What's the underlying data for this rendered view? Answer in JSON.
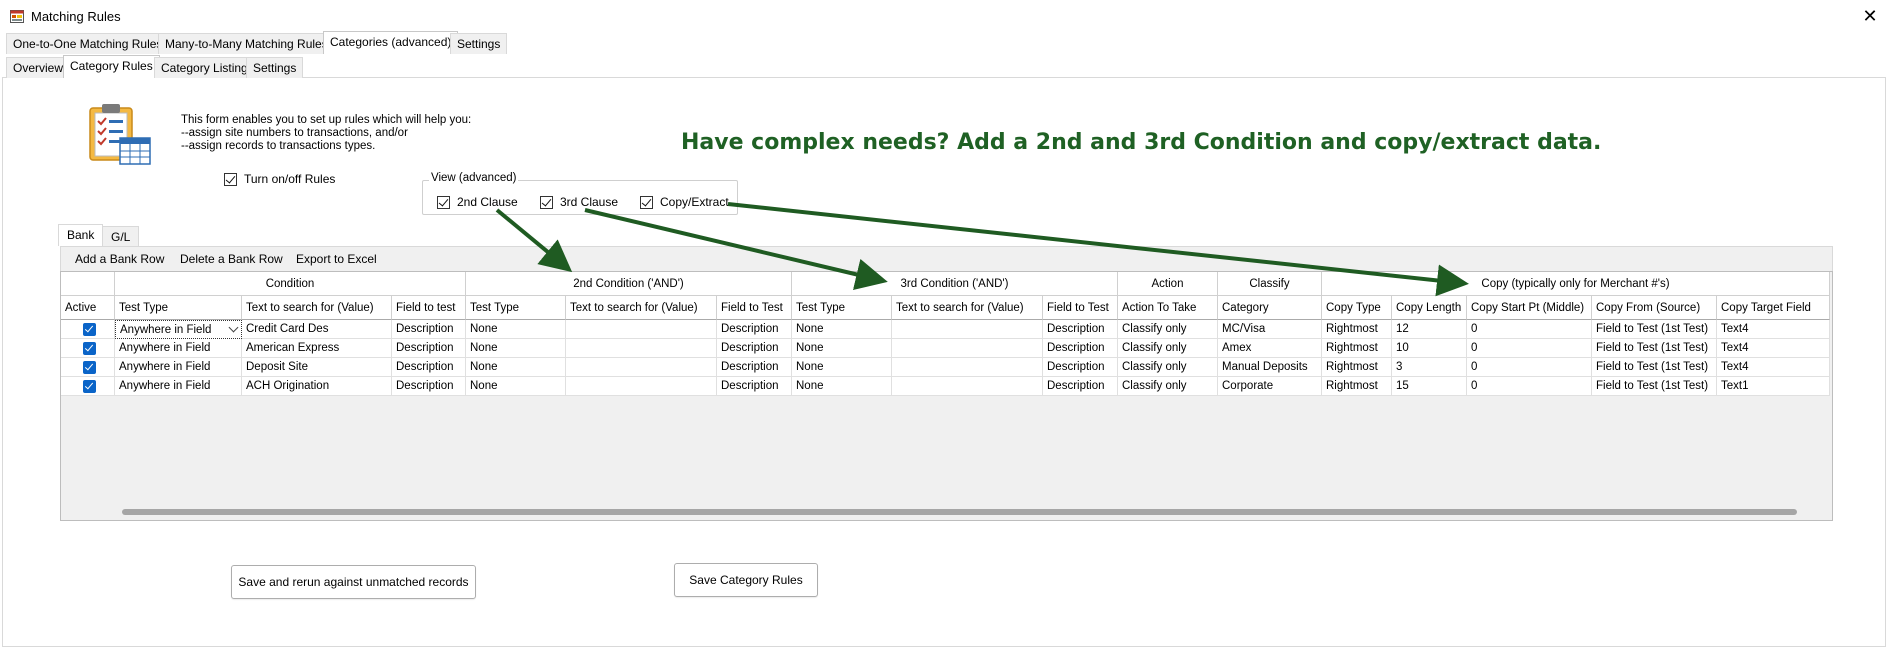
{
  "window": {
    "title": "Matching Rules",
    "close_glyph": "✕"
  },
  "main_tabs": [
    {
      "label": "One-to-One Matching Rules"
    },
    {
      "label": "Many-to-Many Matching Rules"
    },
    {
      "label": "Categories (advanced)"
    },
    {
      "label": "Settings"
    }
  ],
  "sub_tabs": [
    {
      "label": "Overview"
    },
    {
      "label": "Category Rules"
    },
    {
      "label": "Category Listing"
    },
    {
      "label": "Settings"
    }
  ],
  "intro": {
    "line1": "This form enables you to set up rules which will help you:",
    "line2": "--assign site numbers to transactions, and/or",
    "line3": "--assign records to transactions types."
  },
  "headline": "Have complex needs? Add a 2nd and 3rd Condition and copy/extract data.",
  "turn_on_off": {
    "label": "Turn on/off Rules",
    "checked": true
  },
  "view_advanced": {
    "legend": "View (advanced)",
    "second_clause": "2nd Clause",
    "third_clause": "3rd Clause",
    "copy_extract": "Copy/Extract"
  },
  "bank_tabs": [
    {
      "label": "Bank"
    },
    {
      "label": "G/L"
    }
  ],
  "toolbar": {
    "add_row": "Add a Bank Row",
    "delete_row": "Delete a Bank Row",
    "export": "Export to Excel"
  },
  "grid": {
    "groups": {
      "condition": "Condition",
      "cond2": "2nd Condition ('AND')",
      "cond3": "3rd Condition ('AND')",
      "action": "Action",
      "classify": "Classify",
      "copy": "Copy (typically only for Merchant #'s)"
    },
    "headers": {
      "active": "Active",
      "test_type": "Test Type",
      "text_search": "Text to search for (Value)",
      "field_test": "Field to test",
      "test_type2": "Test Type",
      "text_search2": "Text to search for (Value)",
      "field_test2": "Field to Test",
      "test_type3": "Test Type",
      "text_search3": "Text to search for (Value)",
      "field_test3": "Field to Test",
      "action": "Action To Take",
      "category": "Category",
      "copy_type": "Copy Type",
      "copy_length": "Copy Length",
      "copy_start": "Copy Start Pt (Middle)",
      "copy_from": "Copy From (Source)",
      "copy_target": "Copy Target Field"
    },
    "rows": [
      {
        "test_type": "Anywhere in Field",
        "text": "Credit Card Des",
        "field": "Description",
        "tt2": "None",
        "v2": "",
        "f2": "Description",
        "tt3": "None",
        "v3": "",
        "f3": "Description",
        "action": "Classify only",
        "category": "MC/Visa",
        "copy_type": "Rightmost",
        "copy_length": "12",
        "copy_start": "0",
        "copy_from": "Field to Test (1st Test)",
        "copy_target": "Text4"
      },
      {
        "test_type": "Anywhere in Field",
        "text": "American Express",
        "field": "Description",
        "tt2": "None",
        "v2": "",
        "f2": "Description",
        "tt3": "None",
        "v3": "",
        "f3": "Description",
        "action": "Classify only",
        "category": "Amex",
        "copy_type": "Rightmost",
        "copy_length": "10",
        "copy_start": "0",
        "copy_from": "Field to Test (1st Test)",
        "copy_target": "Text4"
      },
      {
        "test_type": "Anywhere in Field",
        "text": "Deposit Site",
        "field": "Description",
        "tt2": "None",
        "v2": "",
        "f2": "Description",
        "tt3": "None",
        "v3": "",
        "f3": "Description",
        "action": "Classify only",
        "category": "Manual Deposits",
        "copy_type": "Rightmost",
        "copy_length": "3",
        "copy_start": "0",
        "copy_from": "Field to Test (1st Test)",
        "copy_target": "Text4"
      },
      {
        "test_type": "Anywhere in Field",
        "text": "ACH Origination",
        "field": "Description",
        "tt2": "None",
        "v2": "",
        "f2": "Description",
        "tt3": "None",
        "v3": "",
        "f3": "Description",
        "action": "Classify only",
        "category": "Corporate",
        "copy_type": "Rightmost",
        "copy_length": "15",
        "copy_start": "0",
        "copy_from": "Field to Test (1st Test)",
        "copy_target": "Text1"
      }
    ]
  },
  "buttons": {
    "save_rerun": "Save and rerun against unmatched records",
    "save_rules": "Save Category Rules"
  },
  "colors": {
    "headline": "#1f6124",
    "arrow": "#1f5b22",
    "checkbox": "#0a64c8"
  },
  "icons": {
    "app": "app-window-icon",
    "clipboard": "clipboard-checklist-icon"
  }
}
